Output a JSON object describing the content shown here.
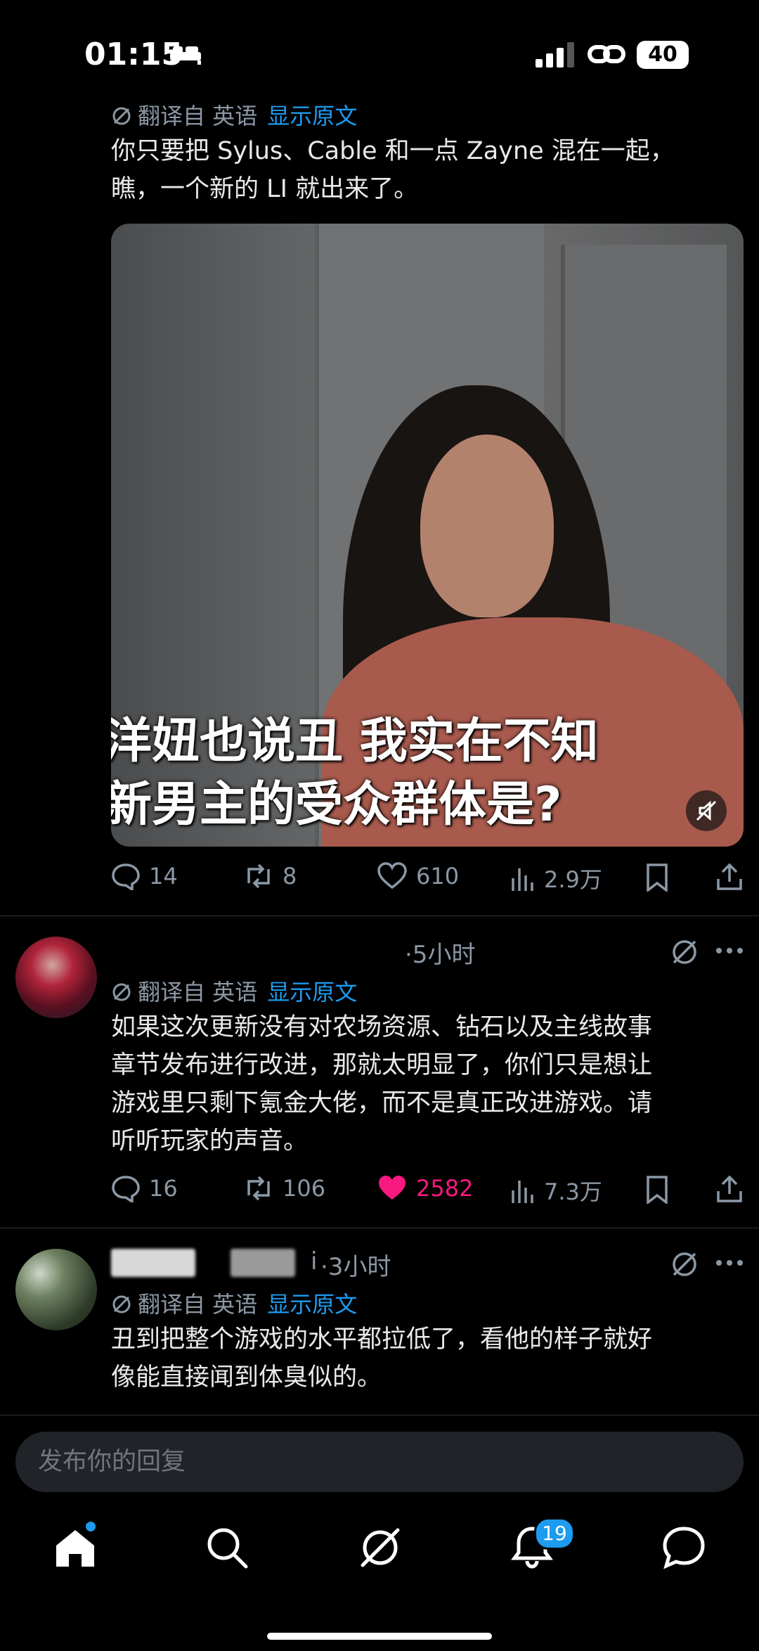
{
  "status": {
    "time": "01:15",
    "battery": "40"
  },
  "translate": {
    "label": "翻译自 英语",
    "show": "显示原文"
  },
  "post1": {
    "text_line1": "你只要把 Sylus、Cable 和一点 Zayne 混在一起，",
    "text_line2": "瞧，一个新的 LI 就出来了。",
    "caption_line1": "洋妞也说丑 我实在不知",
    "caption_line2": "新男主的受众群体是?",
    "replies": "14",
    "reposts": "8",
    "likes": "610",
    "views": "2.9万"
  },
  "post2": {
    "time": "·5小时",
    "text_line1": "如果这次更新没有对农场资源、钻石以及主线故事",
    "text_line2": "章节发布进行改进，那就太明显了，你们只是想让",
    "text_line3": "游戏里只剩下氪金大佬，而不是真正改进游戏。请",
    "text_line4": "听听玩家的声音。",
    "replies": "16",
    "reposts": "106",
    "likes": "2582",
    "views": "7.3万"
  },
  "post3": {
    "name_tail": "i",
    "time": "·3小时",
    "text_line1": "丑到把整个游戏的水平都拉低了，看他的样子就好",
    "text_line2": "像能直接闻到体臭似的。"
  },
  "reply_placeholder": "发布你的回复",
  "nav": {
    "notification_count": "19"
  },
  "colors": {
    "accent": "#1d9bf0",
    "like": "#f91880",
    "muted": "#8b98a5"
  }
}
